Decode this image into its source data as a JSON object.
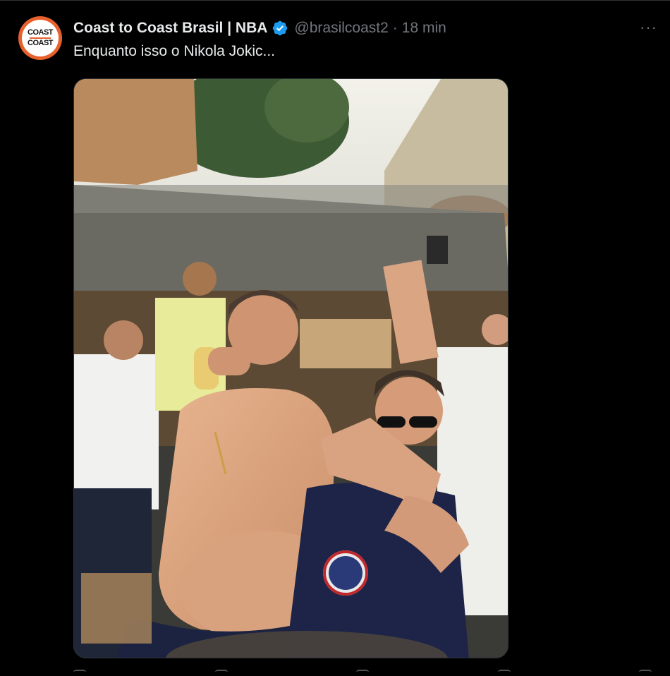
{
  "tweet": {
    "avatar_line1": "COAST",
    "avatar_line2": "COAST",
    "display_name": "Coast to Coast Brasil | NBA",
    "handle": "@brasilcoast2",
    "separator": "·",
    "timestamp": "18 min",
    "text": "Enquanto isso o Nikola Jokic...",
    "more_label": "···"
  },
  "colors": {
    "background": "#000000",
    "primary_text": "#e7e9ea",
    "secondary_text": "#71767b",
    "verified_blue": "#1d9bf0",
    "avatar_orange": "#e8612c"
  },
  "icons": {
    "verified": "verified-badge-icon",
    "more": "more-options-icon"
  }
}
